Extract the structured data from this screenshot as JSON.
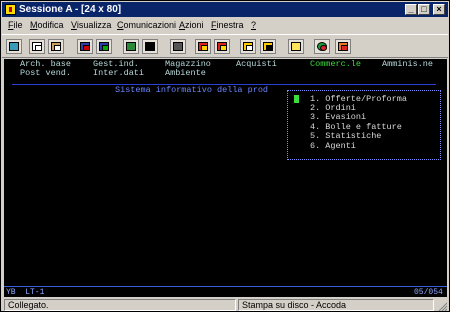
{
  "window": {
    "title": "Sessione A - [24 x 80]",
    "controls": {
      "minimize": "_",
      "maximize": "□",
      "close": "×"
    }
  },
  "menu": {
    "items": [
      "File",
      "Modifica",
      "Visualizza",
      "Comunicazioni",
      "Azioni",
      "Finestra",
      "?"
    ]
  },
  "toolbar": {
    "icons": [
      "print-screen-icon",
      "copy-icon",
      "paste-icon",
      "send-file-icon",
      "receive-file-icon",
      "display-icon",
      "monitor-icon",
      "keyboard-icon",
      "record-macro-icon",
      "play-macro-icon",
      "stop-macro-icon",
      "macro-list-icon",
      "clipboard-icon",
      "globe-icon",
      "support-icon"
    ]
  },
  "terminal": {
    "row1": {
      "arch": "Arch. base",
      "gest": "Gest.ind.",
      "magazzino": "Magazzino",
      "acquisti": "Acquisti",
      "commerc": "Commerc.le",
      "amminis": "Amminis.ne"
    },
    "row2": {
      "post": "Post vend.",
      "inter": "Inter.dati",
      "ambiente": "Ambiente"
    },
    "info_title": "Sistema informativo della prod",
    "options": [
      "1. Offerte/Proforma",
      "2. Ordini",
      "3. Evasioni",
      "4. Bolle e fatture",
      "5. Statistiche",
      "6. Agenti"
    ],
    "colors": {
      "background": "#000000",
      "text": "#b8d8d8",
      "selected": "#3cde3c",
      "accent": "#6b86ff"
    }
  },
  "oia": {
    "left": "YB  LT-1",
    "right": "05/054"
  },
  "status": {
    "connection": "Collegato.",
    "print": "Stampa su disco - Accoda"
  }
}
